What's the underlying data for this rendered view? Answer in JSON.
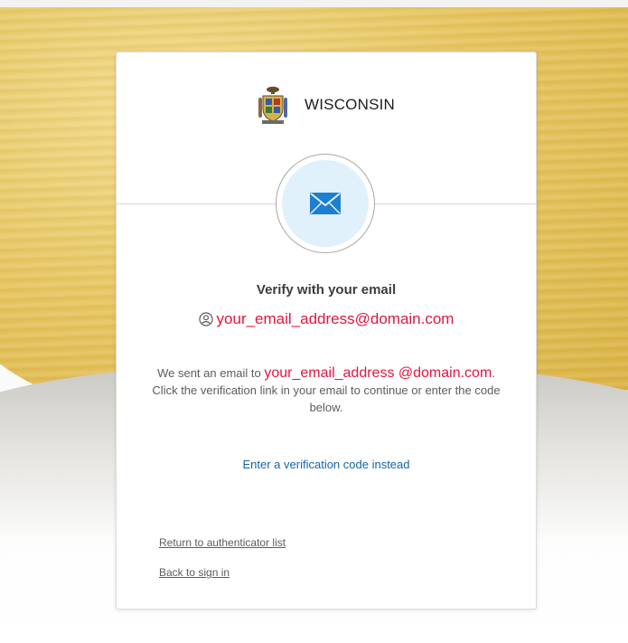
{
  "colors": {
    "accent_email": "#e2163f",
    "link": "#1465a6",
    "icon_bg": "#e1f1fb",
    "icon_blue": "#1c7fd0"
  },
  "header": {
    "brand": "WISCONSIN",
    "logo_icon": "wisconsin-seal-icon"
  },
  "factor": {
    "icon": "envelope-icon",
    "title": "Verify with your email",
    "identifier_icon": "user-circle-icon",
    "identifier": "your_email_address@domain.com"
  },
  "message": {
    "prefix": "We sent an email to ",
    "email": "your_email_address @domain.com",
    "suffix": ". Click the verification link in your email to continue or enter the code below."
  },
  "actions": {
    "enter_code": "Enter a verification code instead",
    "return_list": "Return to authenticator list",
    "back_signin": "Back to sign in"
  }
}
